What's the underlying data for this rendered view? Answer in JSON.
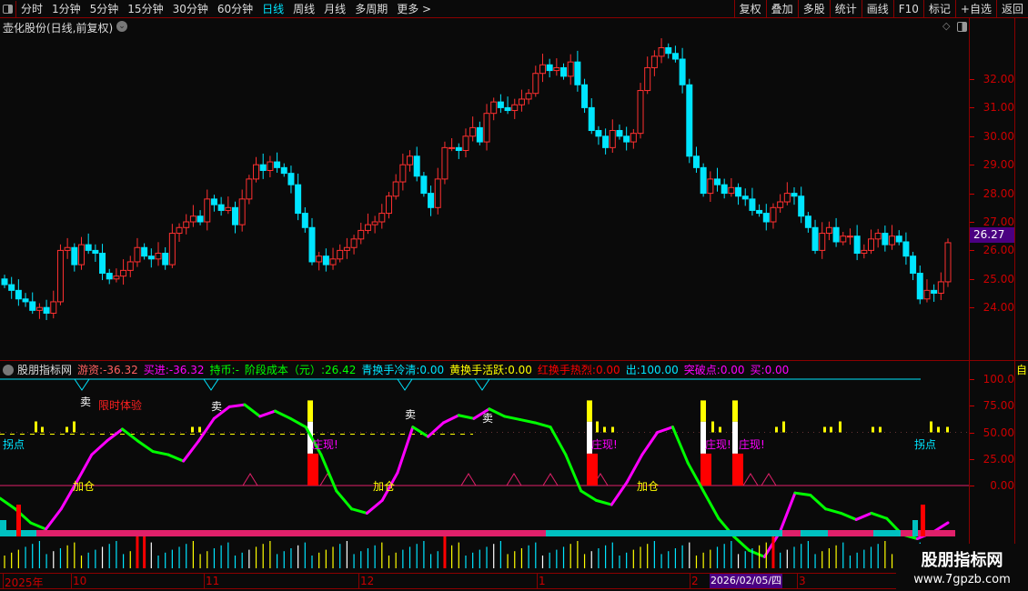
{
  "toolbar": {
    "periods": [
      "分时",
      "1分钟",
      "5分钟",
      "15分钟",
      "30分钟",
      "60分钟",
      "日线",
      "周线",
      "月线",
      "多周期",
      "更多 >"
    ],
    "active_period": "日线",
    "right_buttons": [
      "复权",
      "叠加",
      "多股",
      "统计",
      "画线",
      "F10",
      "标记",
      "+自选",
      "返回"
    ]
  },
  "main_chart": {
    "title": "壶化股份(日线,前复权)",
    "current_price": "26.27",
    "y_ticks": [
      "32.00",
      "31.00",
      "30.00",
      "29.00",
      "28.00",
      "27.00",
      "26.00",
      "25.00",
      "24.00"
    ]
  },
  "indicator": {
    "name": "股朋指标网",
    "fields": [
      {
        "label": "游资",
        "value": "-36.32",
        "color": "#ff6060"
      },
      {
        "label": "买进",
        "value": "-36.32",
        "color": "#ff00ff"
      },
      {
        "label": "持币",
        "value": "-",
        "color": "#00ff00"
      },
      {
        "label": "阶段成本（元）",
        "value": "26.42",
        "color": "#00ff00"
      },
      {
        "label": "青换手冷清",
        "value": "0.00",
        "color": "#00e5ff"
      },
      {
        "label": "黄换手活跃",
        "value": "0.00",
        "color": "#ffff00"
      },
      {
        "label": "红换手热烈",
        "value": "0.00",
        "color": "#ff0000"
      },
      {
        "label": "出",
        "value": "100.00",
        "color": "#00e5ff"
      },
      {
        "label": "突破点",
        "value": "0.00",
        "color": "#ff00ff"
      },
      {
        "label": "买",
        "value": "0.00",
        "color": "#ff00ff"
      }
    ],
    "y_ticks": [
      "100.0",
      "75.00",
      "50.00",
      "25.00",
      "0.00"
    ],
    "annotations": {
      "sell": "卖",
      "trial": "限时体验",
      "turn": "拐点",
      "add": "加仓",
      "dealer": "庄现!"
    }
  },
  "x_axis": {
    "labels": [
      "2025年",
      "10",
      "11",
      "12",
      "1",
      "2",
      "3"
    ],
    "cursor_date": "2026/02/05/四"
  },
  "watermark": {
    "line1": "股朋指标网",
    "line2": "www.7gpzb.com"
  },
  "chart_data": {
    "type": "candlestick",
    "price_range": [
      23.0,
      33.5
    ],
    "closes": [
      24.8,
      24.6,
      24.3,
      24.2,
      23.9,
      24.0,
      23.8,
      24.2,
      26.0,
      26.1,
      25.5,
      26.2,
      26.0,
      25.9,
      25.2,
      25.0,
      25.1,
      25.3,
      25.6,
      26.1,
      25.8,
      25.7,
      25.9,
      25.5,
      26.6,
      26.8,
      27.0,
      27.2,
      27.0,
      27.8,
      27.6,
      27.4,
      27.5,
      26.9,
      27.8,
      28.5,
      29.0,
      28.8,
      29.1,
      28.9,
      28.7,
      28.3,
      27.3,
      26.8,
      25.6,
      25.8,
      25.5,
      25.7,
      26.0,
      26.1,
      26.4,
      26.7,
      26.9,
      27.0,
      27.3,
      27.9,
      28.4,
      29.0,
      29.3,
      28.6,
      28.0,
      27.5,
      28.5,
      29.6,
      29.6,
      29.5,
      30.0,
      30.3,
      29.8,
      30.8,
      31.2,
      31.0,
      30.9,
      31.1,
      31.3,
      31.5,
      32.2,
      32.5,
      32.3,
      32.4,
      32.1,
      32.6,
      31.8,
      31.0,
      30.2,
      30.0,
      29.6,
      30.2,
      30.0,
      29.8,
      30.1,
      31.6,
      32.4,
      32.8,
      33.1,
      32.9,
      32.7,
      31.8,
      29.3,
      28.9,
      28.0,
      28.5,
      28.3,
      28.0,
      28.2,
      27.9,
      27.8,
      27.4,
      27.3,
      27.0,
      27.5,
      27.7,
      28.0,
      27.9,
      27.2,
      26.8,
      26.0,
      26.6,
      26.8,
      26.3,
      26.5,
      26.5,
      25.9,
      26.0,
      26.4,
      26.6,
      26.2,
      26.5,
      26.3,
      25.8,
      25.2,
      24.3,
      24.6,
      24.5,
      24.9,
      26.27
    ],
    "indicator_range": [
      -70,
      100
    ],
    "indicator_line": [
      -12,
      -22,
      -35,
      -41,
      -22,
      3,
      29,
      42,
      53,
      42,
      32,
      29,
      23,
      42,
      63,
      74,
      76,
      65,
      70,
      63,
      55,
      29,
      -5,
      -22,
      -26,
      -14,
      12,
      55,
      46,
      59,
      66,
      63,
      72,
      65,
      62,
      59,
      55,
      29,
      -5,
      -14,
      -18,
      3,
      29,
      50,
      55,
      21,
      -5,
      -31,
      -48,
      -61,
      -67,
      -44,
      -7,
      -9,
      -22,
      -26,
      -32,
      -26,
      -31,
      -46,
      -50,
      -44,
      -35
    ]
  }
}
